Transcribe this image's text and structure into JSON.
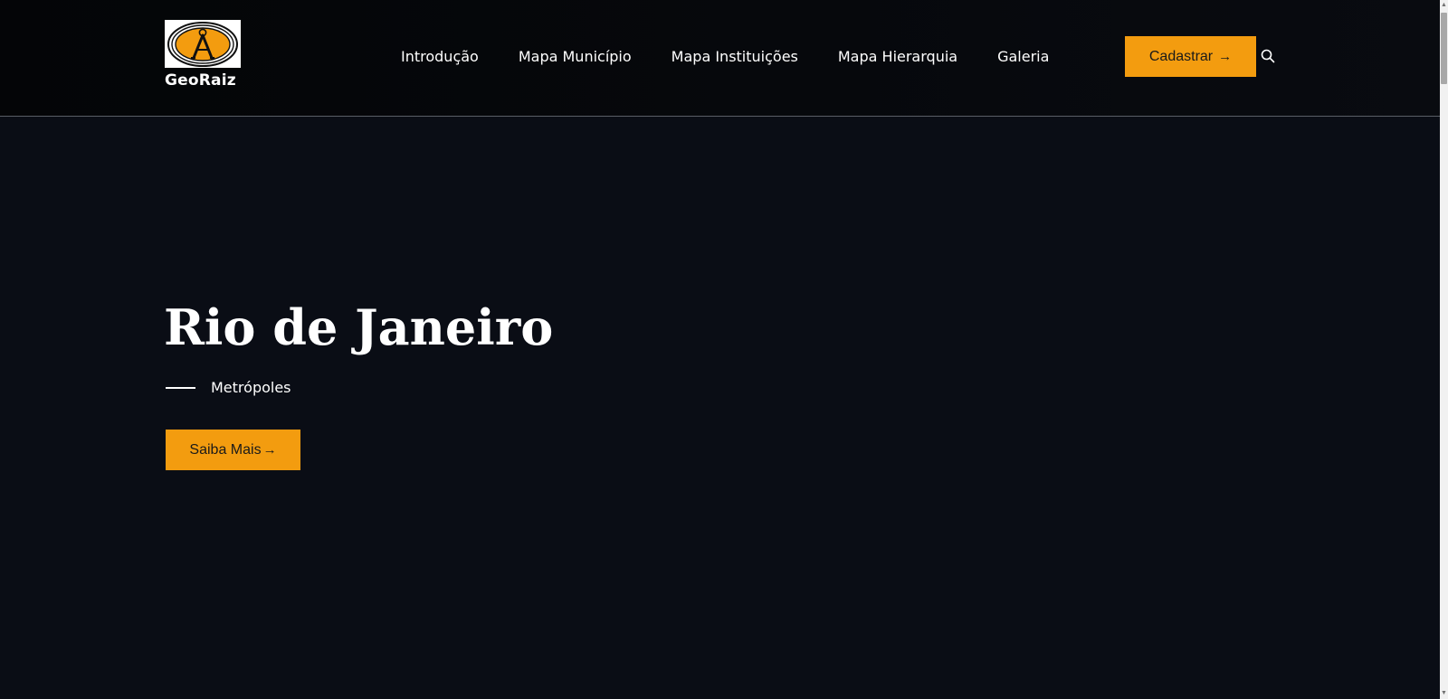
{
  "header": {
    "logo": {
      "text": "GeoRaiz",
      "icon": "compass-logo-icon",
      "accent_color": "#f39c0f"
    },
    "nav": [
      {
        "label": "Introdução"
      },
      {
        "label": "Mapa Município"
      },
      {
        "label": "Mapa Instituições"
      },
      {
        "label": "Mapa Hierarquia"
      },
      {
        "label": "Galeria"
      }
    ],
    "cta": {
      "label": "Cadastrar",
      "icon": "arrow-right-icon"
    },
    "search": {
      "icon": "search-icon"
    }
  },
  "hero": {
    "title": "Rio de Janeiro",
    "subtitle": "Metrópoles",
    "button": {
      "label": "Saiba Mais",
      "icon": "arrow-right-icon"
    }
  },
  "colors": {
    "background": "#0a0d15",
    "header_background": "#040507",
    "accent": "#f39c0f",
    "text": "#ffffff"
  }
}
